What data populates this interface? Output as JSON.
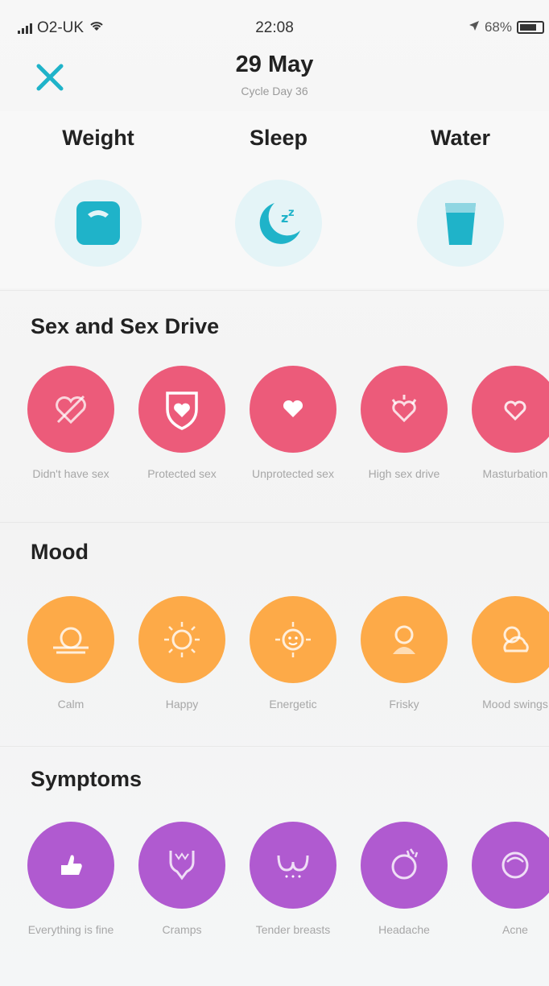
{
  "status_bar": {
    "carrier": "O2-UK",
    "time": "22:08",
    "battery": "68%"
  },
  "header": {
    "date": "29 May",
    "cycle_day": "Cycle Day 36"
  },
  "trackers": [
    {
      "label": "Weight",
      "icon": "scale-icon"
    },
    {
      "label": "Sleep",
      "icon": "moon-zzz-icon"
    },
    {
      "label": "Water",
      "icon": "glass-icon"
    }
  ],
  "sex": {
    "title": "Sex and Sex Drive",
    "items": [
      {
        "label": "Didn't have sex",
        "icon": "crossed-heart-icon"
      },
      {
        "label": "Protected sex",
        "icon": "shield-heart-icon"
      },
      {
        "label": "Unprotected sex",
        "icon": "heart-icon"
      },
      {
        "label": "High sex drive",
        "icon": "flame-heart-icon"
      },
      {
        "label": "Masturbation",
        "icon": "outline-heart-icon"
      }
    ]
  },
  "mood": {
    "title": "Mood",
    "items": [
      {
        "label": "Calm",
        "icon": "calm-sun-icon"
      },
      {
        "label": "Happy",
        "icon": "sun-icon"
      },
      {
        "label": "Energetic",
        "icon": "sun-face-icon"
      },
      {
        "label": "Frisky",
        "icon": "frisky-icon"
      },
      {
        "label": "Mood swings",
        "icon": "sun-cloud-icon"
      }
    ]
  },
  "symptoms": {
    "title": "Symptoms",
    "items": [
      {
        "label": "Everything is fine",
        "icon": "thumbs-up-icon"
      },
      {
        "label": "Cramps",
        "icon": "cramps-icon"
      },
      {
        "label": "Tender breasts",
        "icon": "breasts-icon"
      },
      {
        "label": "Headache",
        "icon": "headache-icon"
      },
      {
        "label": "Acne",
        "icon": "acne-icon"
      }
    ]
  },
  "colors": {
    "accent_teal": "#1fb3c9",
    "sex": "#ec5b7a",
    "mood": "#fdaa48",
    "symptoms": "#b05ad0"
  }
}
